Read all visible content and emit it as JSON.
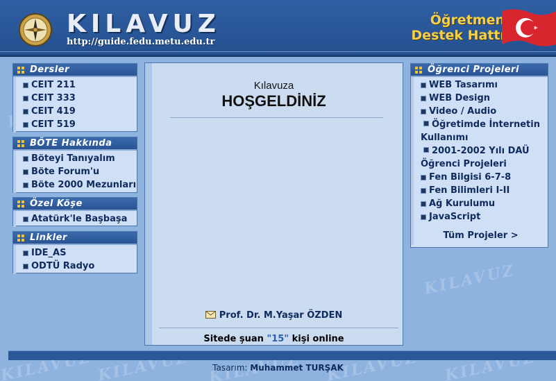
{
  "header": {
    "title": "KILAVUZ",
    "url": "http://guide.fedu.metu.edu.tr",
    "hotline_line1": "Öğretmen",
    "hotline_line2": "Destek Hattı"
  },
  "watermark": "KILAVUZ",
  "dersler": {
    "title": "Dersler",
    "items": [
      "CEIT 211",
      "CEIT 333",
      "CEIT 419",
      "CEIT 519"
    ]
  },
  "bote": {
    "title": "BÖTE Hakkında",
    "items": [
      "Böteyi Tanıyalım",
      "Böte Forum'u",
      "Böte 2000 Mezunları"
    ]
  },
  "ozel": {
    "title": "Özel Köşe",
    "items": [
      "Atatürk'le Başbaşa"
    ]
  },
  "linkler": {
    "title": "Linkler",
    "items": [
      "IDE_AS",
      "ODTÜ Radyo"
    ]
  },
  "projeler": {
    "title": "Öğrenci Projeleri",
    "items": [
      "WEB Tasarımı",
      "WEB Design",
      "Video / Audio",
      "Öğretimde İnternetin Kullanımı",
      "2001-2002 Yılı DAÜ Öğrenci Projeleri",
      "Fen Bilgisi 6-7-8",
      "Fen Bilimleri I-II",
      "Ağ Kurulumu",
      "JavaScript"
    ],
    "more": "Tüm Projeler >"
  },
  "main": {
    "welcome_small": "Kılavuza",
    "welcome_big": "HOŞGELDİNİZ",
    "author": "Prof. Dr. M.Yaşar ÖZDEN",
    "online_prefix": "Sitede şuan",
    "online_count": "\"15\"",
    "online_suffix": "kişi online"
  },
  "footer": {
    "label": "Tasarım:",
    "designer": "Muhammet TURŞAK"
  },
  "colors": {
    "background": "#8fb3df",
    "header": "#2f5fa3",
    "panel": "#cfe0f6",
    "accent": "#f7d04a"
  }
}
